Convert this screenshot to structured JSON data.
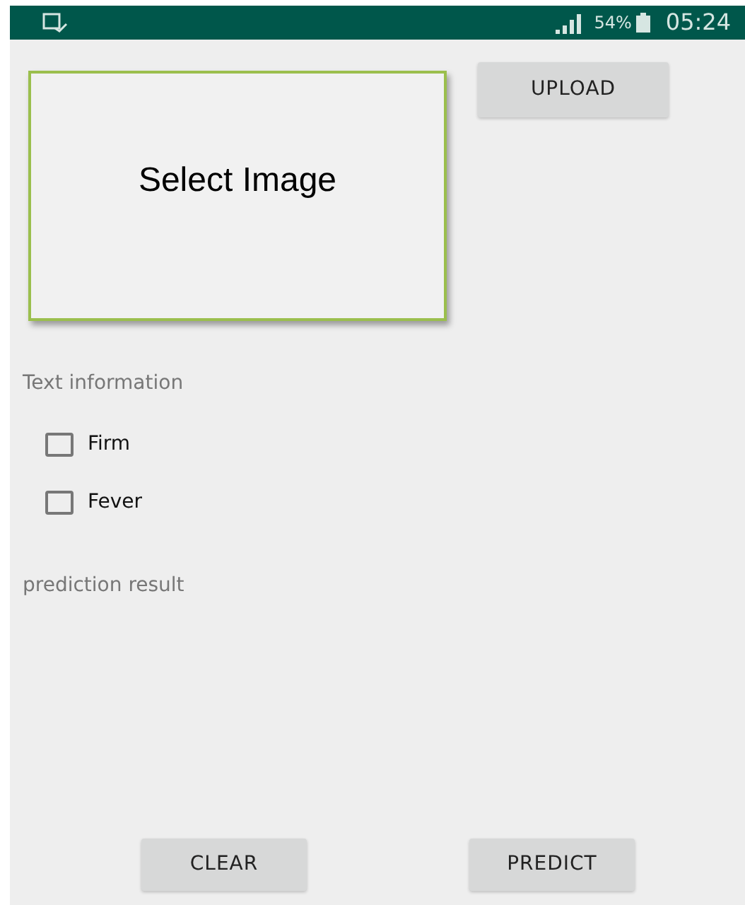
{
  "status_bar": {
    "battery": "54%",
    "time": "05:24"
  },
  "image_box": {
    "label": "Select Image"
  },
  "upload_button": "UPLOAD",
  "section_label": "Text information",
  "checkboxes": [
    {
      "label": "Firm",
      "checked": false
    },
    {
      "label": "Fever",
      "checked": false
    }
  ],
  "result_label": "prediction result",
  "buttons": [
    "CLEAR",
    "PREDICT"
  ]
}
